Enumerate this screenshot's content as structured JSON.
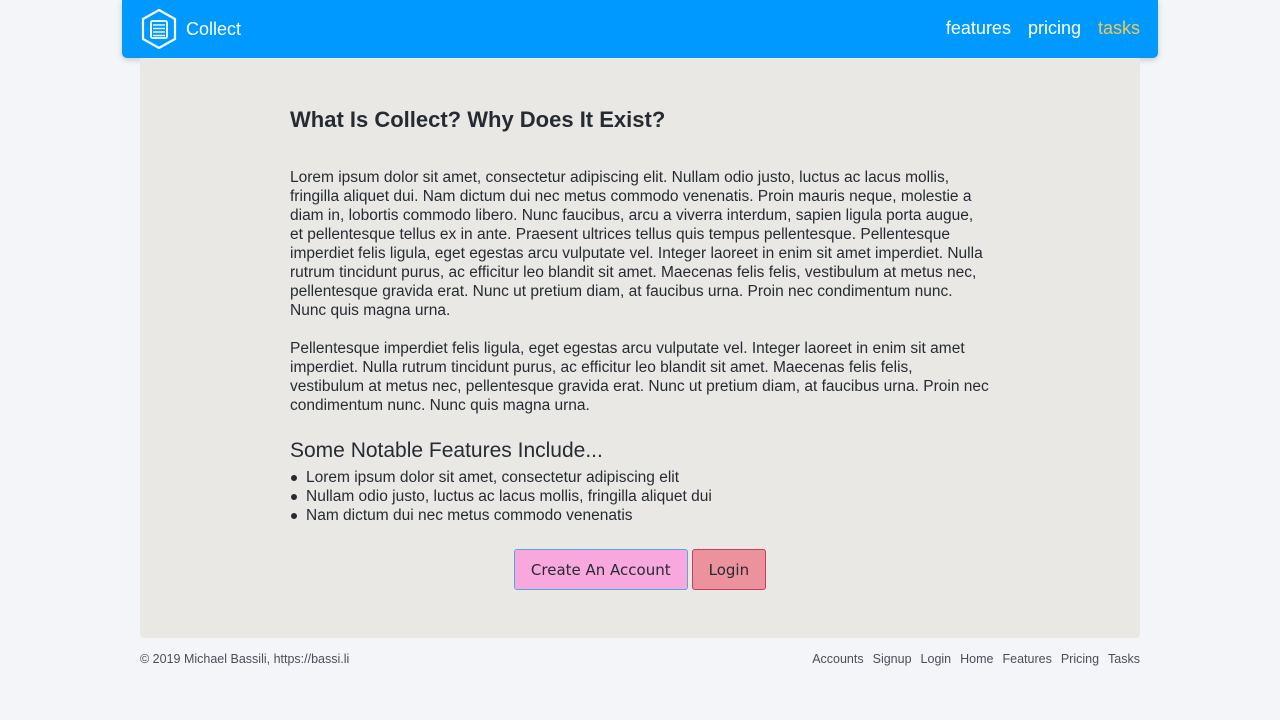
{
  "navbar": {
    "brand": "Collect",
    "brand_color": "#0099ff",
    "logo_icon": "document-list-icon",
    "links": [
      {
        "label": "features",
        "active": false
      },
      {
        "label": "pricing",
        "active": false
      },
      {
        "label": "tasks",
        "active": true
      }
    ],
    "active_color": "#f2c94c"
  },
  "main": {
    "title": "What Is Collect? Why Does It Exist?",
    "paragraphs": [
      "Lorem ipsum dolor sit amet, consectetur adipiscing elit. Nullam odio justo, luctus ac lacus mollis, fringilla aliquet dui. Nam dictum dui nec metus commodo venenatis. Proin mauris neque, molestie a diam in, lobortis commodo libero. Nunc faucibus, arcu a viverra interdum, sapien ligula porta augue, et pellentesque tellus ex in ante. Praesent ultrices tellus quis tempus pellentesque. Pellentesque imperdiet felis ligula, eget egestas arcu vulputate vel. Integer laoreet in enim sit amet imperdiet. Nulla rutrum tincidunt purus, ac efficitur leo blandit sit amet. Maecenas felis felis, vestibulum at metus nec, pellentesque gravida erat. Nunc ut pretium diam, at faucibus urna. Proin nec condimentum nunc. Nunc quis magna urna.",
      "Pellentesque imperdiet felis ligula, eget egestas arcu vulputate vel. Integer laoreet in enim sit amet imperdiet. Nulla rutrum tincidunt purus, ac efficitur leo blandit sit amet. Maecenas felis felis, vestibulum at metus nec, pellentesque gravida erat. Nunc ut pretium diam, at faucibus urna. Proin nec condimentum nunc. Nunc quis magna urna."
    ],
    "features_title": "Some Notable Features Include...",
    "features": [
      "Lorem ipsum dolor sit amet, consectetur adipiscing elit",
      "Nullam odio justo, luctus ac lacus mollis, fringilla aliquet dui",
      "Nam dictum dui nec metus commodo venenatis"
    ],
    "buttons": {
      "create_label": "Create An Account",
      "login_label": "Login",
      "create_color": "#f9a8de",
      "login_color": "#ec929c"
    }
  },
  "footer": {
    "copyright": "© 2019 Michael Bassili, https://bassi.li",
    "links": [
      "Accounts",
      "Signup",
      "Login",
      "Home",
      "Features",
      "Pricing",
      "Tasks"
    ]
  }
}
